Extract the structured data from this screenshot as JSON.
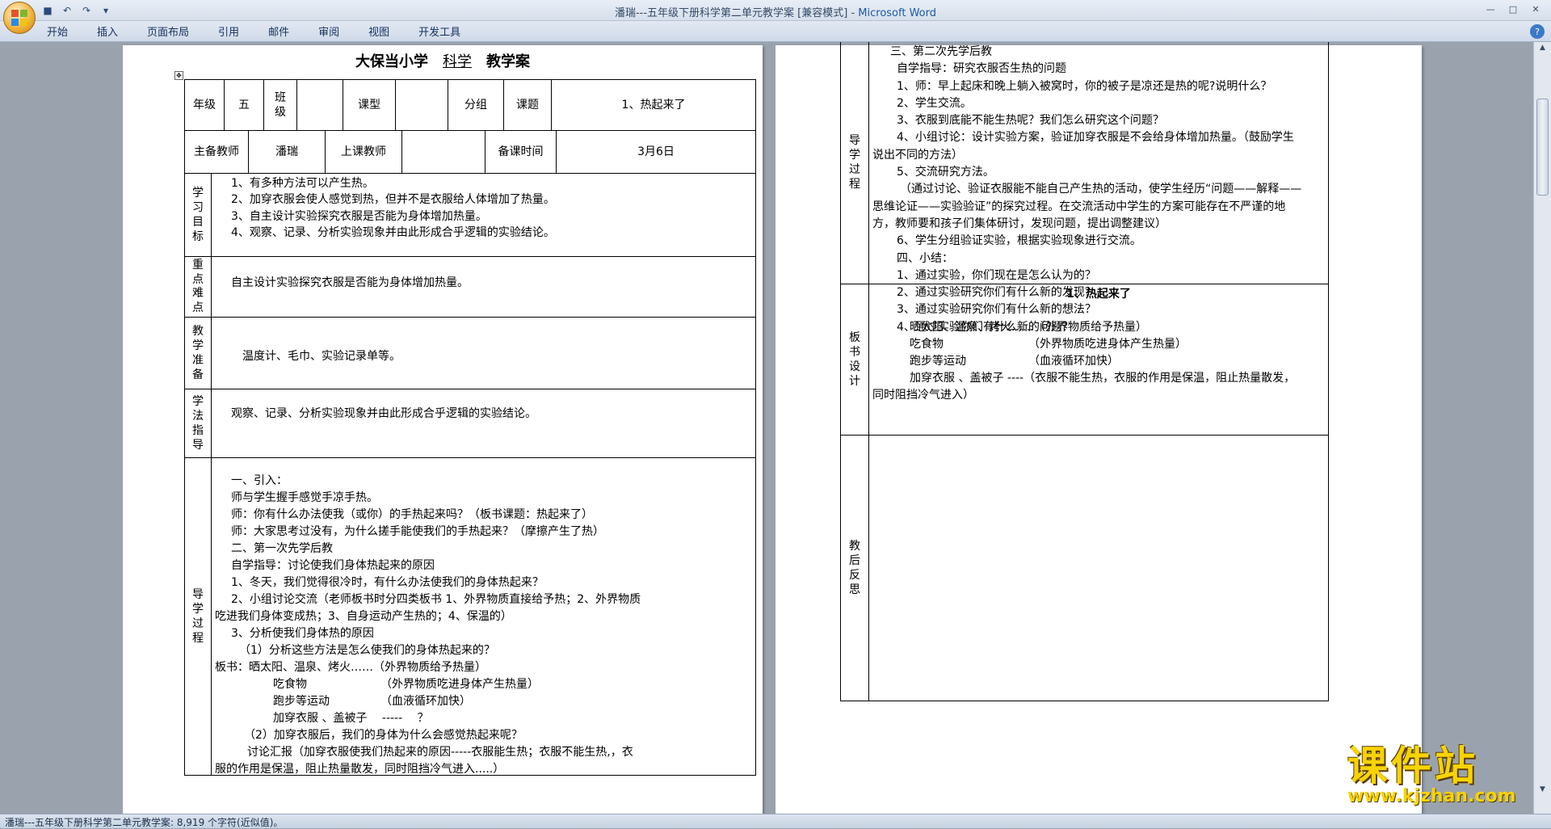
{
  "window": {
    "title": "潘瑞---五年级下册科学第二单元教学案 [兼容模式]",
    "app_name": "Microsoft Word",
    "title_sep": " - "
  },
  "ribbon": {
    "tabs": [
      "开始",
      "插入",
      "页面布局",
      "引用",
      "邮件",
      "审阅",
      "视图",
      "开发工具"
    ]
  },
  "doc": {
    "title_school": "大保当小学",
    "title_subject": "科学",
    "title_suffix": "教学案",
    "labels": {
      "grade": "年级",
      "grade_val": "五",
      "class": "班级",
      "course_type": "课型",
      "group": "分组",
      "topic": "课题",
      "topic_val": "1、热起来了",
      "lead_teacher": "主备教师",
      "lead_teacher_val": "潘瑞",
      "class_teacher": "上课教师",
      "prep_time": "备课时间",
      "prep_time_val": "3月6日",
      "goals": "学习目标",
      "key_points": "重点难点",
      "prep": "教学准备",
      "method": "学法指导",
      "process": "导学过程",
      "board": "板书设计",
      "reflection": "教后反思"
    },
    "goals": [
      "1、有多种方法可以产生热。",
      "2、加穿衣服会使人感觉到热，但并不是衣服给人体增加了热量。",
      "3、自主设计实验探究衣服是否能为身体增加热量。",
      "4、观察、记录、分析实验现象并由此形成合乎逻辑的实验结论。"
    ],
    "key_points": "自主设计实验探究衣服是否能为身体增加热量。",
    "prep": "温度计、毛巾、实验记录单等。",
    "method": "观察、记录、分析实验现象并由此形成合乎逻辑的实验结论。",
    "process1": [
      "一、引入：",
      "师与学生握手感觉手凉手热。",
      "师：你有什么办法使我（或你）的手热起来吗？（板书课题：热起来了）",
      "师：大家思考过没有，为什么搓手能使我们的手热起来？（摩擦产生了热）",
      "二、第一次先学后教",
      "自学指导：讨论使我们身体热起来的原因",
      "1、冬天，我们觉得很冷时，有什么办法使我们的身体热起来？",
      "2、小组讨论交流（老师板书时分四类板书 1、外界物质直接给予热；2、外界物质",
      "吃进我们身体变成热；3、自身运动产生热的；4、保温的）",
      "3、分析使我们身体热的原因",
      "（1）分析这些方法是怎么使我们的身体热起来的？",
      "板书：晒太阳、温泉、烤火……（外界物质给予热量）",
      "吃食物　　　　　　　（外界物质吃进身体产生热量）",
      "跑步等运动　　　　　（血液循环加快）",
      "加穿衣服 、盖被子　 -----　 ？",
      "（2）加穿衣服后，我们的身体为什么会感觉热起来呢？",
      "讨论汇报（加穿衣服使我们热起来的原因-----衣服能生热；衣服不能生热,，衣",
      "服的作用是保温，阻止热量散发，同时阻挡冷气进入.....）"
    ],
    "process2": [
      "三、第二次先学后教",
      "自学指导：研究衣服否生热的问题",
      "1、师：早上起床和晚上躺入被窝时，你的被子是凉还是热的呢?说明什么？",
      "2、学生交流。",
      "3、衣服到底能不能生热呢？我们怎么研究这个问题？",
      "4、小组讨论：设计实验方案，验证加穿衣服是不会给身体增加热量。（鼓励学生",
      "说出不同的方法）",
      "5、交流研究方法。",
      "（通过讨论、验证衣服能不能自己产生热的活动，使学生经历“问题——解释——",
      "思维论证——实验验证”的探究过程。在交流活动中学生的方案可能存在不严谨的地",
      "方，教师要和孩子们集体研讨，发现问题，提出调整建议）",
      "6、学生分组验证实验，根据实验现象进行交流。",
      "四、小结：",
      "1、通过实验，你们现在是怎么认为的？",
      "2、通过实验研究你们有什么新的发现？",
      "3、通过实验研究你们有什么新的想法？",
      "4、通过实验你们有什么新的问题？"
    ],
    "board_title": "1、热起来了",
    "board": [
      "晒太阳、温泉、烤火……（外界物质给予热量）",
      "吃食物　　　　　　　　（外界物质吃进身体产生热量）",
      "跑步等运动　　　　　　（血液循环加快）",
      "加穿衣服 、盖被子 ----（衣服不能生热，衣服的作用是保温，阻止热量散发，",
      "同时阻挡冷气进入）"
    ]
  },
  "status": {
    "text": "潘瑞---五年级下册科学第二单元教学案: 8,919 个字符(近似值)。"
  },
  "watermark": {
    "title": "课件站",
    "url": "www.kjzhan.com"
  }
}
